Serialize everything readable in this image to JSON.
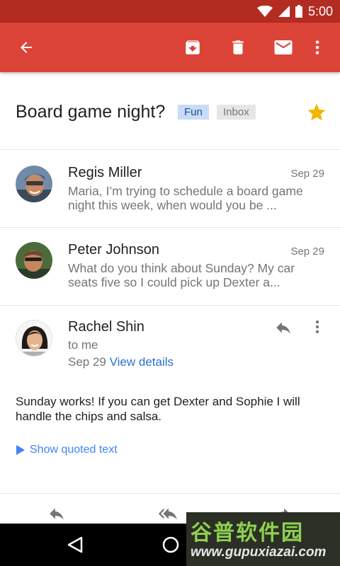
{
  "status_bar": {
    "time": "5:00"
  },
  "app_bar": {
    "back_icon": "arrow-back-icon",
    "actions": [
      "archive-icon",
      "delete-icon",
      "mark-unread-icon",
      "more-vert-icon"
    ]
  },
  "thread": {
    "subject": "Board game night?",
    "labels": [
      "Fun",
      "Inbox"
    ],
    "starred": true
  },
  "messages": [
    {
      "sender": "Regis Miller",
      "date": "Sep 29",
      "snippet": "Maria, I’m trying to schedule a board game night this week, when would you be ..."
    },
    {
      "sender": "Peter Johnson",
      "date": "Sep 29",
      "snippet": "What do you think about Sunday? My car seats five so I could pick up Dexter a..."
    }
  ],
  "expanded": {
    "sender": "Rachel Shin",
    "recipient": "to me",
    "date": "Sep 29",
    "view_details": "View details",
    "body": "Sunday works! If you can get Dexter and Sophie I will handle the chips and salsa.",
    "show_quoted": "Show quoted text"
  },
  "watermark": {
    "name": "谷普软件园",
    "url": "www.gupuxiazai.com"
  },
  "colors": {
    "app_bar": "#db4437",
    "status_bar": "#b32c22",
    "label_fun_bg": "#c8dcf7",
    "label_inbox_bg": "#e6e6e6",
    "star": "#f4b400",
    "link": "#2a6fd6"
  }
}
